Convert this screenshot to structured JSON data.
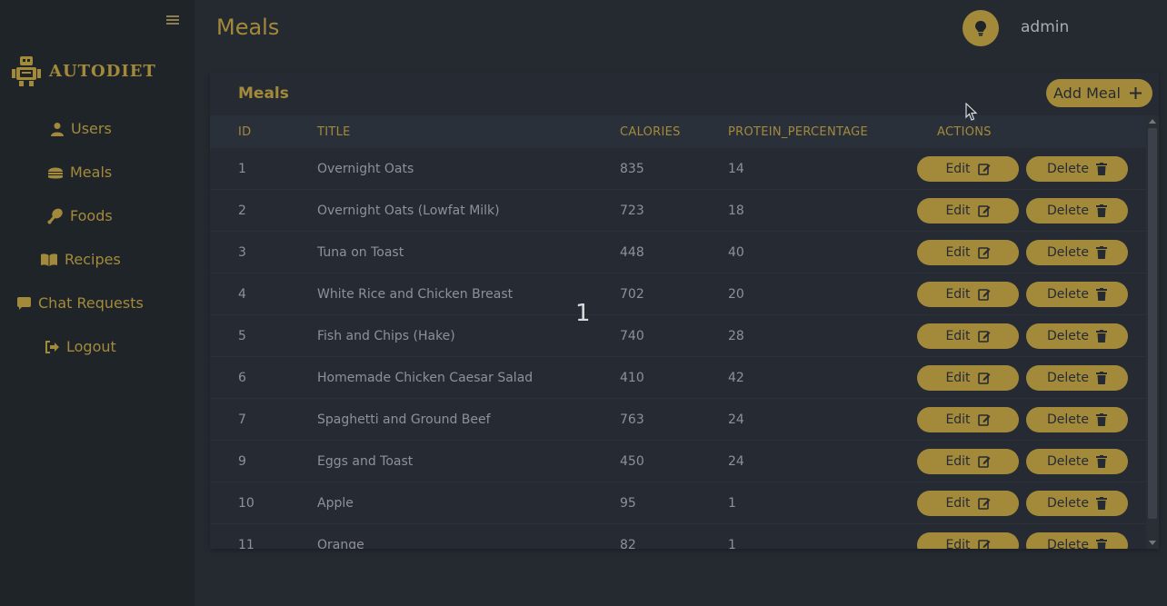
{
  "sidebar": {
    "brand": "AUTODIET",
    "items": [
      {
        "label": "Users"
      },
      {
        "label": "Meals"
      },
      {
        "label": "Foods"
      },
      {
        "label": "Recipes"
      },
      {
        "label": "Chat Requests"
      },
      {
        "label": "Logout"
      }
    ]
  },
  "header": {
    "title": "Meals",
    "user": "admin"
  },
  "card": {
    "title": "Meals",
    "add_label": "Add Meal"
  },
  "table": {
    "columns": [
      "ID",
      "TITLE",
      "CALORIES",
      "PROTEIN_PERCENTAGE",
      "ACTIONS"
    ],
    "edit_label": "Edit",
    "delete_label": "Delete",
    "rows": [
      {
        "id": "1",
        "title": "Overnight Oats",
        "calories": "835",
        "protein": "14"
      },
      {
        "id": "2",
        "title": "Overnight Oats (Lowfat Milk)",
        "calories": "723",
        "protein": "18"
      },
      {
        "id": "3",
        "title": "Tuna on Toast",
        "calories": "448",
        "protein": "40"
      },
      {
        "id": "4",
        "title": "White Rice and Chicken Breast",
        "calories": "702",
        "protein": "20"
      },
      {
        "id": "5",
        "title": "Fish and Chips (Hake)",
        "calories": "740",
        "protein": "28"
      },
      {
        "id": "6",
        "title": "Homemade Chicken Caesar Salad",
        "calories": "410",
        "protein": "42"
      },
      {
        "id": "7",
        "title": "Spaghetti and Ground Beef",
        "calories": "763",
        "protein": "24"
      },
      {
        "id": "9",
        "title": "Eggs and Toast",
        "calories": "450",
        "protein": "24"
      },
      {
        "id": "10",
        "title": "Apple",
        "calories": "95",
        "protein": "1"
      },
      {
        "id": "11",
        "title": "Orange",
        "calories": "82",
        "protein": "1"
      }
    ]
  },
  "overlay": {
    "text": "1"
  },
  "colors": {
    "accent": "#a38a3b",
    "background": "#252a31",
    "sidebar": "#1f2429"
  }
}
